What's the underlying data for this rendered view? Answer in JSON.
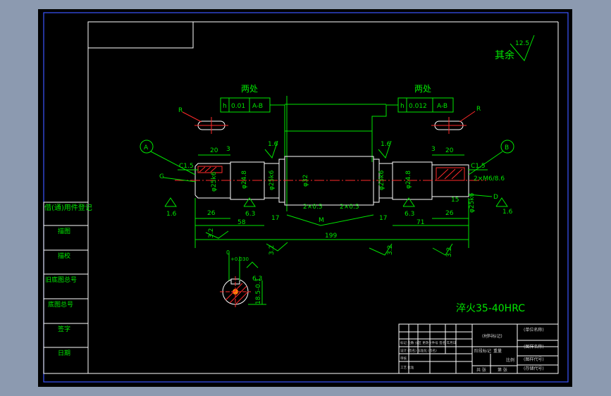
{
  "roughness": {
    "rest_label": "其余",
    "rest_value": "12.5"
  },
  "tolerance": [
    {
      "heading": "两处",
      "symbol": "h",
      "value": "0.01",
      "datum": "A-B"
    },
    {
      "heading": "两处",
      "symbol": "h",
      "value": "0.012",
      "datum": "A-B"
    }
  ],
  "datums": [
    "A",
    "B"
  ],
  "labels": {
    "R_left": "R",
    "R_right": "R",
    "C_left": "C1.5",
    "C_right": "C1.5",
    "G": "G",
    "D": "D",
    "thread": "2×M6/8.6",
    "ra_left": "1.6",
    "ra_right": "1.6",
    "ra_top_left": "1.6",
    "ra_top_right": "1.6",
    "ra_63_a": "6.3",
    "ra_63_b": "6.3",
    "ra_63_c": "6.3",
    "ra_32_a": "3.2",
    "ra_32_b": "3.2",
    "ra_32_c": "3.2",
    "ra_32_d": "3.2",
    "dim_20_l": "20",
    "dim_20_r": "20",
    "dim_3_l": "3",
    "dim_3_r": "3",
    "dim_26_l": "26",
    "dim_26_r": "26",
    "dim_58": "58",
    "dim_71": "71",
    "dim_17_l": "17",
    "dim_17_r": "17",
    "dim_199": "199",
    "dim_M": "M",
    "dim_2x05_l": "2×0.5",
    "dim_2x05_r": "2×0.5",
    "dim_15": "15",
    "d_left_end": "φ25k6",
    "d_left_2": "φ24.8",
    "d_left_3": "φ25k6",
    "d_center": "φ32",
    "d_right_1": "φ25k6",
    "d_right_2": "φ24.8",
    "d_right_end": "φ25k6",
    "section_a": "0",
    "section_b": "+0.030",
    "section_depth": "18.5-0.1"
  },
  "heat_treatment": "淬火35-40HRC",
  "side_panel": [
    "借(通)用件登记",
    "描图",
    "描校",
    "旧底图总号",
    "底图总号",
    "签字",
    "日期"
  ],
  "title_block": {
    "material_label": "(材料标记)",
    "unit_name": "(单位名称)",
    "drawing_name": "(图样名称)",
    "drawing_code": "(图样代号)",
    "storage_code": "(存储代号)",
    "rows": [
      "标记 处数 分区 更改文件号 签名 年月日",
      "设计 (签名) 标准化 (签名)",
      "审核",
      "工艺 批准"
    ],
    "stage_label": "阶段标记",
    "weight_label": "重量",
    "scale_label": "比例",
    "sheet_total": "共 张",
    "sheet_no": "第 张"
  }
}
